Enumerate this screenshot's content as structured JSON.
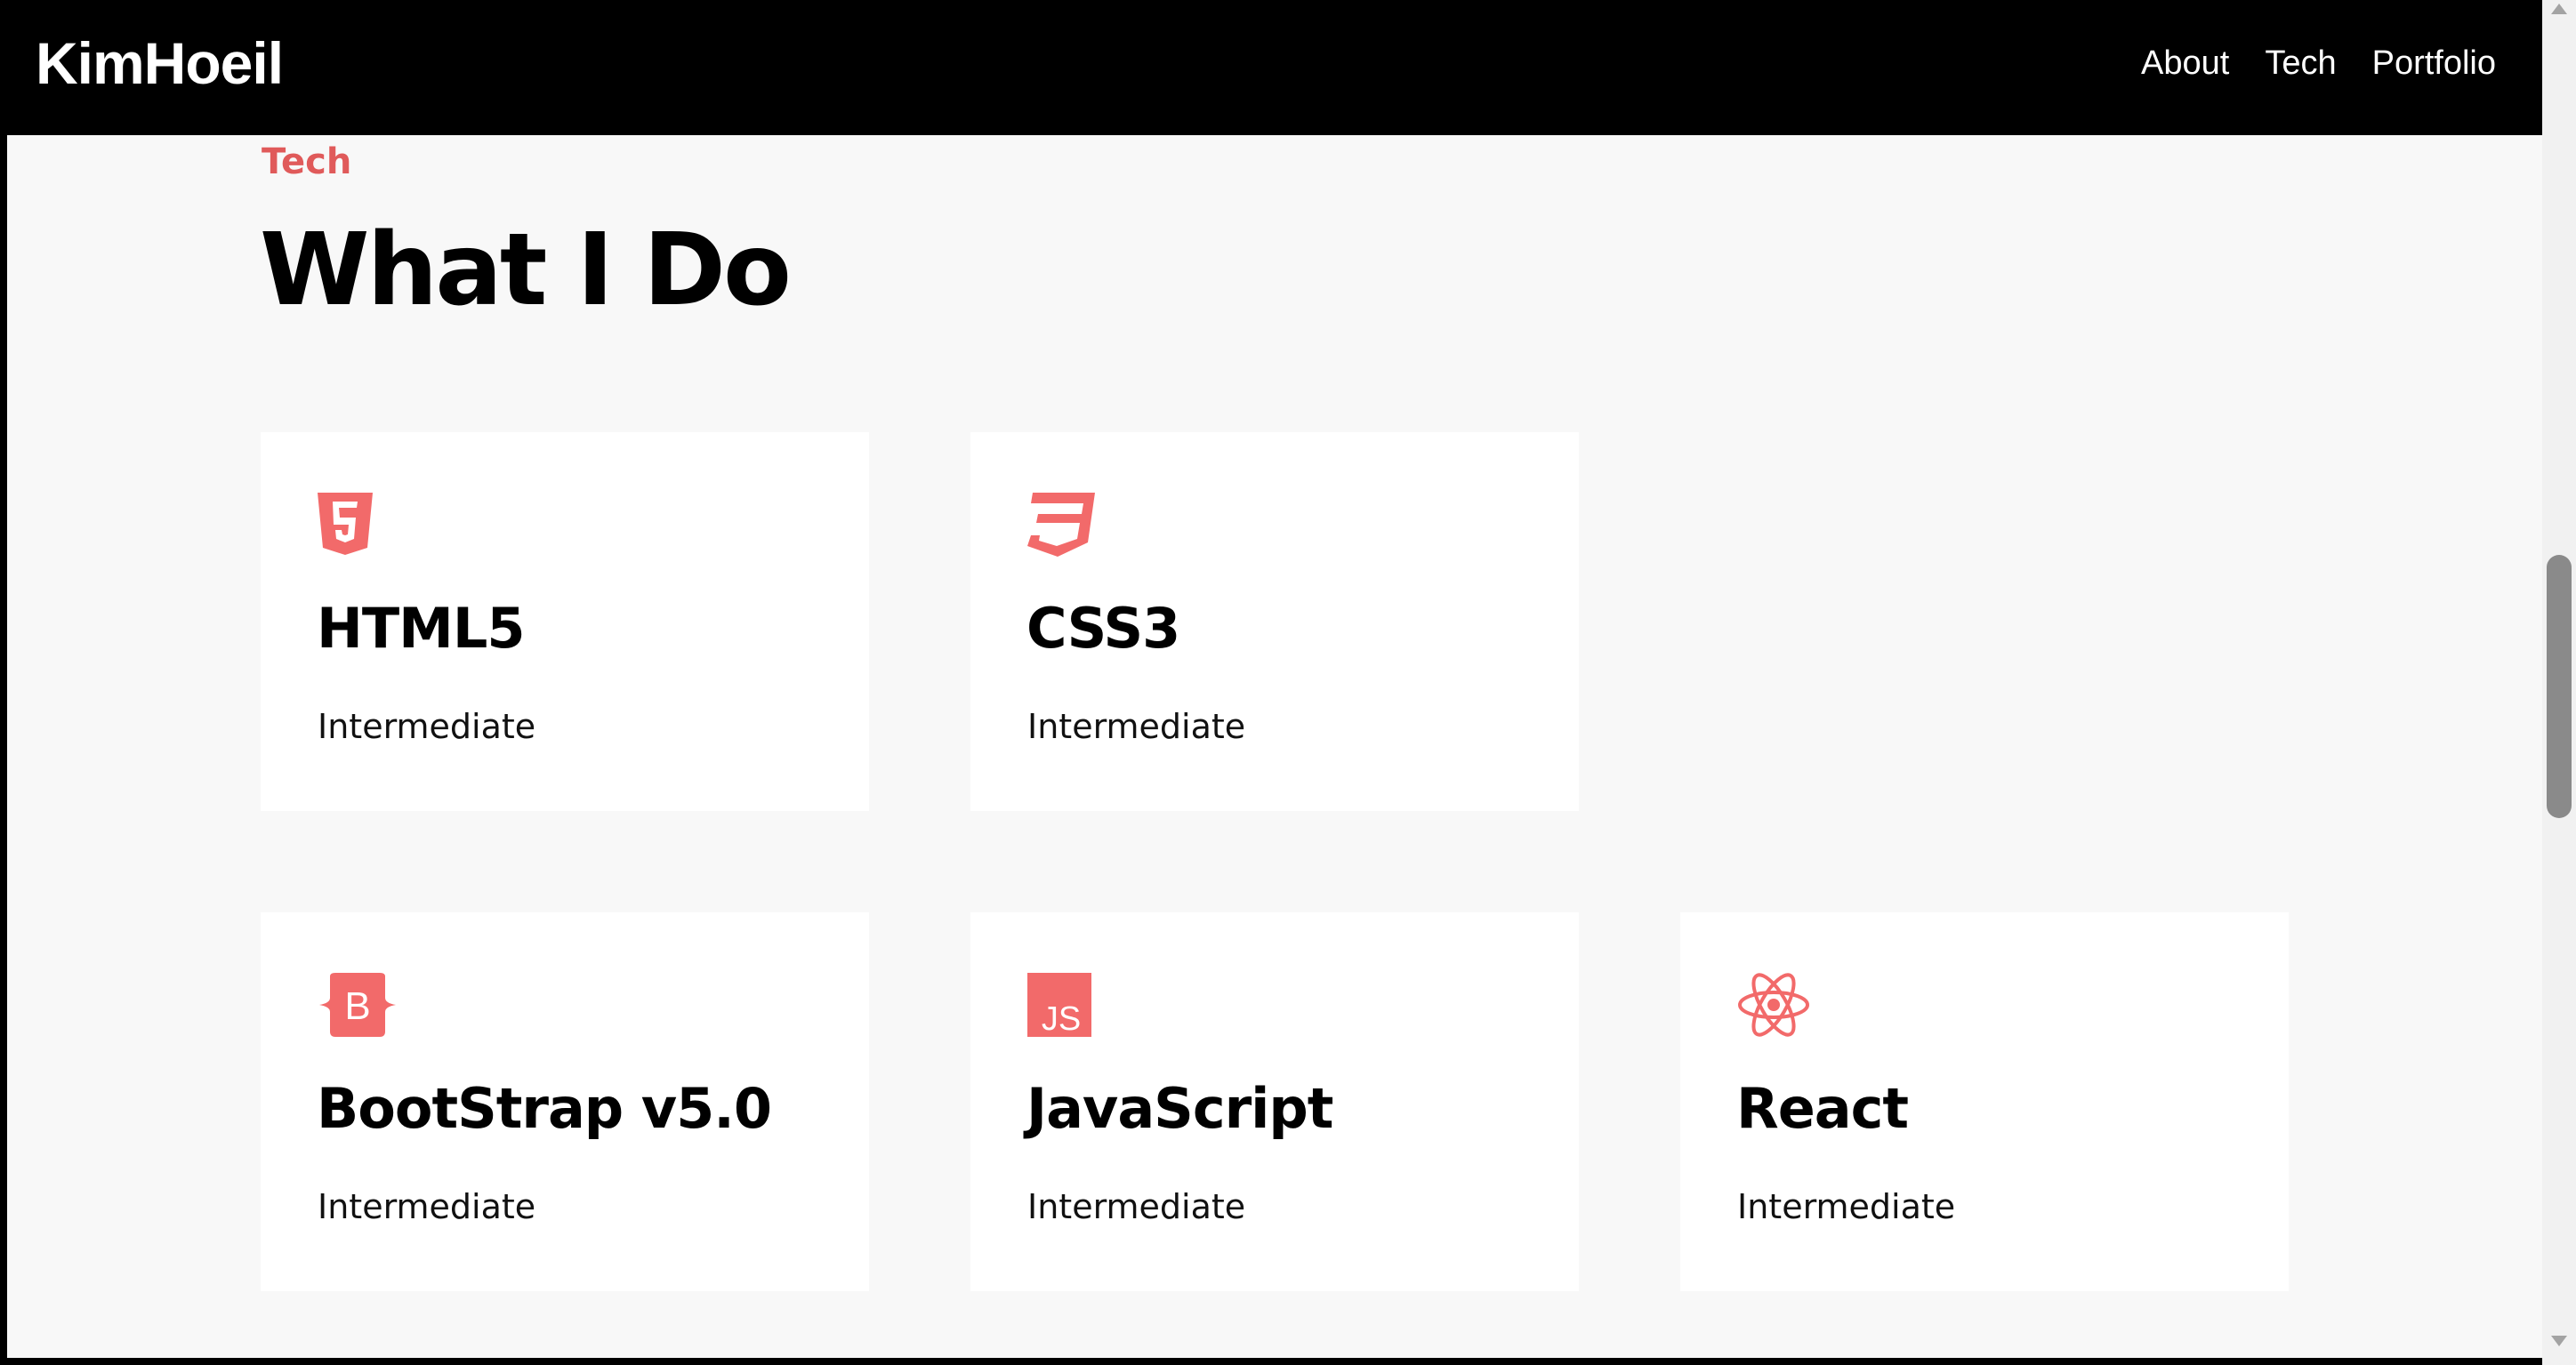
{
  "navbar": {
    "brand": "KimHoeil",
    "links": [
      "About",
      "Tech",
      "Portfolio"
    ]
  },
  "section": {
    "label": "Tech",
    "title": "What I Do"
  },
  "cards": [
    {
      "icon": "html5-icon",
      "name": "HTML5",
      "level": "Intermediate"
    },
    {
      "icon": "css3-icon",
      "name": "CSS3",
      "level": "Intermediate"
    },
    {
      "icon": "bootstrap-icon",
      "name": "BootStrap v5.0",
      "level": "Intermediate"
    },
    {
      "icon": "javascript-icon",
      "name": "JavaScript",
      "level": "Intermediate"
    },
    {
      "icon": "react-icon",
      "name": "React",
      "level": "Intermediate"
    }
  ],
  "colors": {
    "accent": "#e05a5a",
    "icon": "#f26a6a",
    "navbar_bg": "#000000",
    "page_bg": "#f8f8f8",
    "card_bg": "#ffffff"
  }
}
